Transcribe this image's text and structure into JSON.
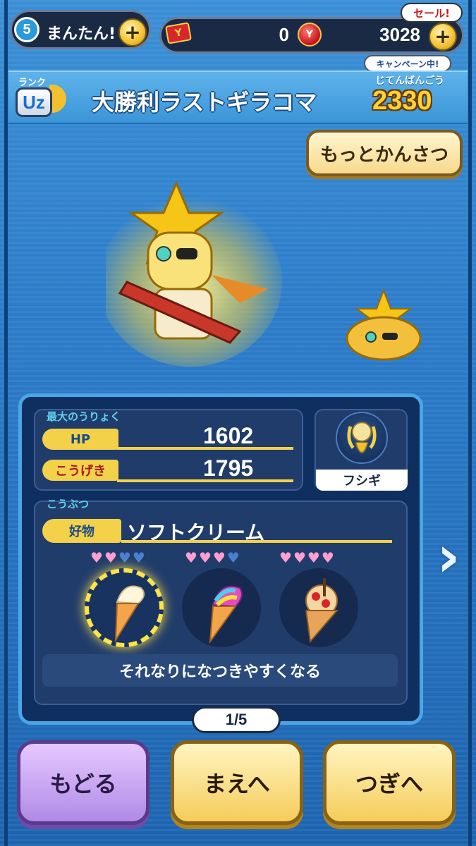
{
  "topbar": {
    "difficulty_level": "5",
    "difficulty_label": "まんたん!",
    "ticket_count": "0",
    "orb_count": "3028",
    "sale_label": "セール!",
    "campaign_label": "キャンペーン中!",
    "plus": "+"
  },
  "header": {
    "rank_label": "ランク",
    "rank_value": "Uz",
    "monster_name": "大勝利ラストギラコマ",
    "dex_label": "じてんばんごう",
    "dex_number": "2330"
  },
  "observe_button": "もっとかんさつ",
  "stats": {
    "heading": "最大のうりょく",
    "hp_label": "HP",
    "hp_value": "1602",
    "attack_label": "こうげき",
    "attack_value": "1795"
  },
  "tribe": {
    "label": "フシギ",
    "icon": "fushigi-tribe-icon"
  },
  "food": {
    "heading": "こうぶつ",
    "fav_label": "好物",
    "fav_value": "ソフトクリーム",
    "items": [
      {
        "name": "soft-serve-icon",
        "hearts_full": 2,
        "hearts_total": 4,
        "selected": true
      },
      {
        "name": "rainbow-soft-serve-icon",
        "hearts_full": 3,
        "hearts_total": 4,
        "selected": false
      },
      {
        "name": "crepe-parfait-icon",
        "hearts_full": 4,
        "hearts_total": 4,
        "selected": false
      }
    ],
    "effect_text": "それなりになつきやすくなる"
  },
  "pagination": "1/5",
  "buttons": {
    "back": "もどる",
    "prev": "まえへ",
    "next": "つぎへ"
  },
  "colors": {
    "accent_yellow": "#f3d24a",
    "panel_bg": "#0f2f60",
    "stat_cyan": "#5fd3f0"
  }
}
